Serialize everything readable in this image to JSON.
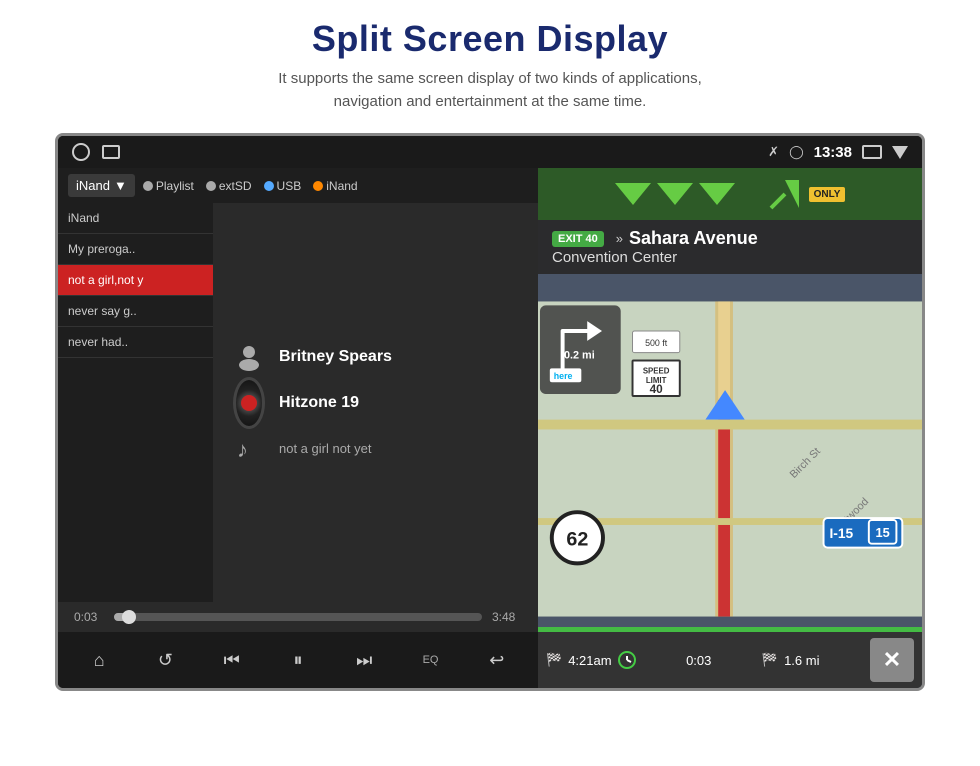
{
  "header": {
    "title": "Split Screen Display",
    "subtitle_line1": "It supports the same screen display of two kinds of applications,",
    "subtitle_line2": "navigation and entertainment at the same time."
  },
  "status_bar": {
    "time": "13:38",
    "bluetooth_icon": "bluetooth",
    "location_icon": "location-pin"
  },
  "music_player": {
    "source_dropdown_label": "iNand",
    "source_options": [
      {
        "label": "Playlist",
        "type": "playlist"
      },
      {
        "label": "extSD",
        "type": "extsd"
      },
      {
        "label": "USB",
        "type": "usb"
      },
      {
        "label": "iNand",
        "type": "inand",
        "active": true
      }
    ],
    "playlist": [
      {
        "label": "iNand",
        "active": false
      },
      {
        "label": "My preroga..",
        "active": false
      },
      {
        "label": "not a girl,not y",
        "active": true
      },
      {
        "label": "never say g..",
        "active": false
      },
      {
        "label": "never had..",
        "active": false
      }
    ],
    "track_artist": "Britney Spears",
    "track_album": "Hitzone 19",
    "track_title": "not a girl not yet",
    "time_current": "0:03",
    "time_total": "3:48",
    "controls": {
      "home": "⌂",
      "repeat": "↺",
      "prev": "⏮",
      "play_pause": "⏸",
      "next": "⏭",
      "eq": "EQ",
      "back": "↩"
    }
  },
  "navigation": {
    "exit_number": "EXIT 40",
    "street_name": "Sahara Avenue",
    "venue": "Convention Center",
    "speed": "62",
    "highway": "I-15",
    "highway_number": "15",
    "distance_to_turn": "0.2 mi",
    "distance_total": "1.6 mi",
    "arrival_time": "4:21am",
    "elapsed_time": "0:03",
    "limit_text": "SPEED LIMIT 40",
    "only_badge": "ONLY",
    "close_btn": "✕",
    "sahara_sign": "Sahara Avenue"
  }
}
